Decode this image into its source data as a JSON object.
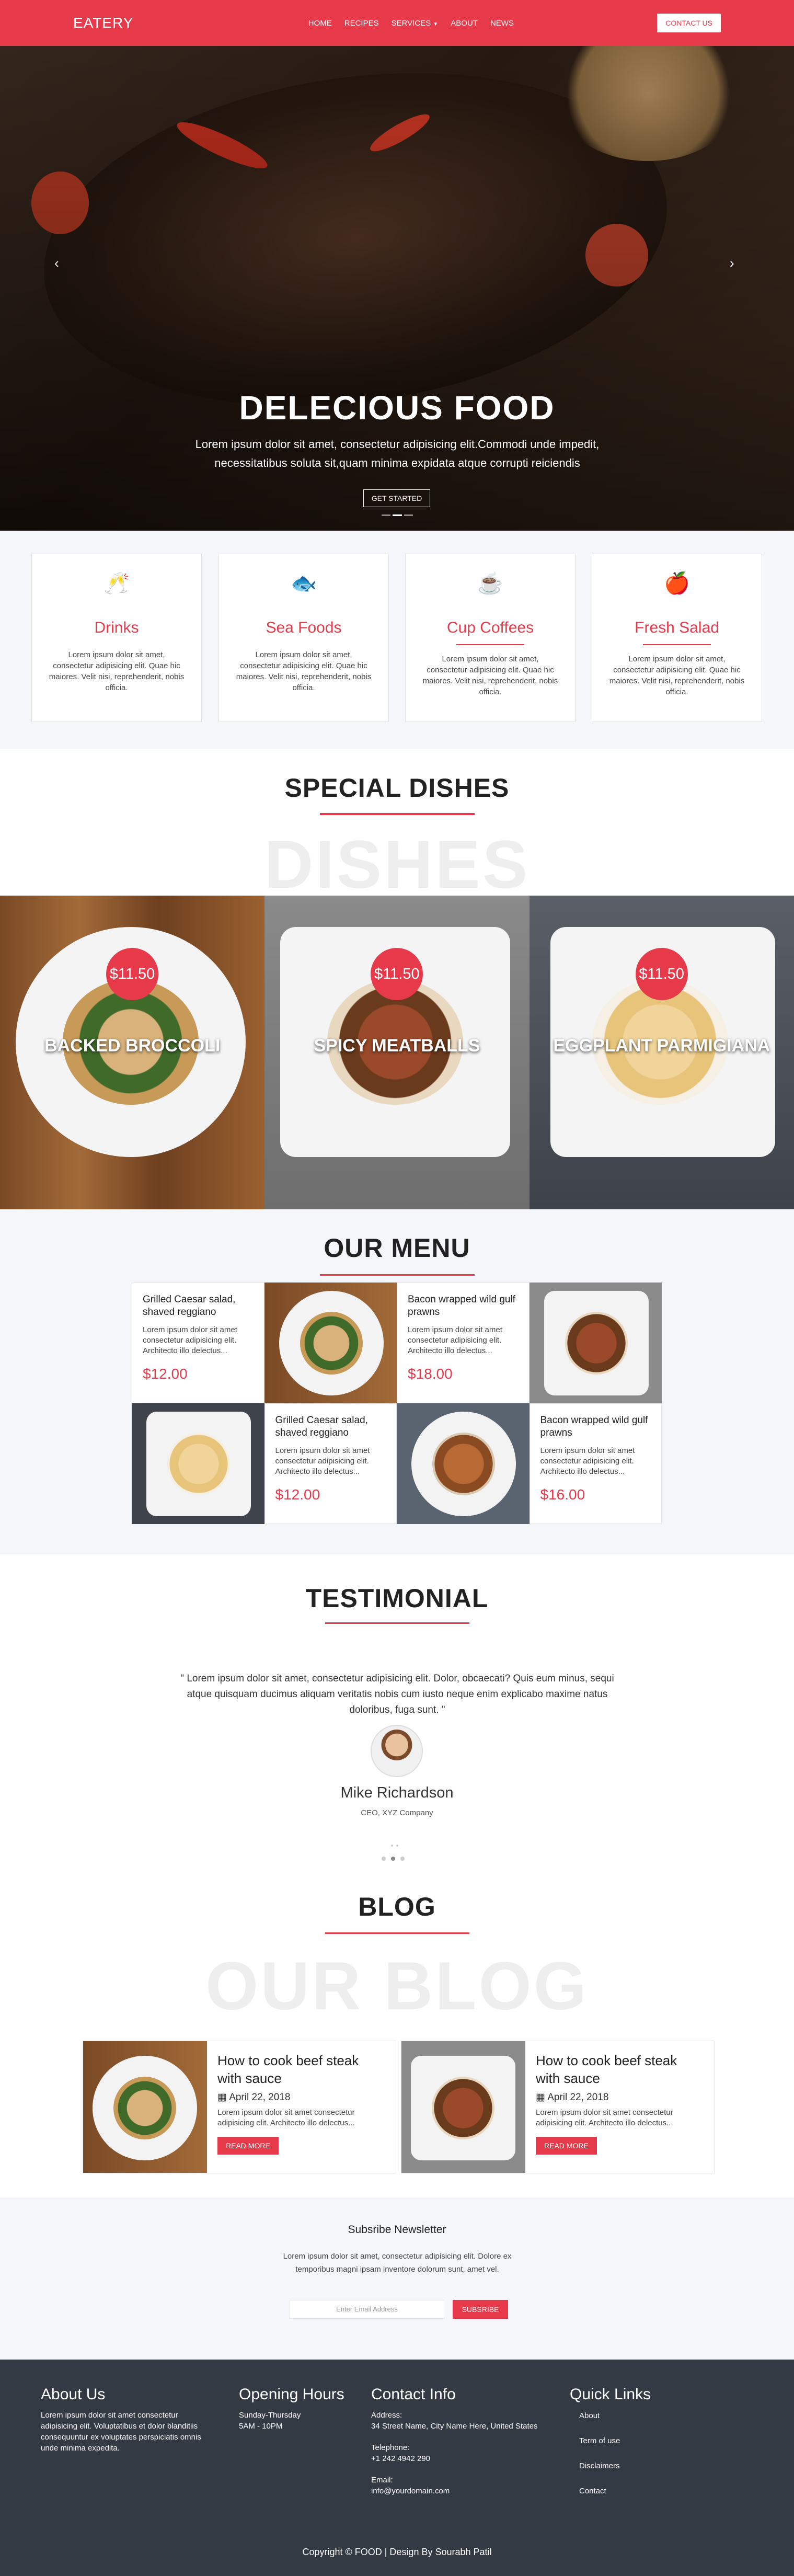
{
  "nav": {
    "logo": "EATERY",
    "items": [
      "HOME",
      "RECIPES",
      "SERVICES",
      "ABOUT",
      "NEWS"
    ],
    "contact": "CONTACT US"
  },
  "hero": {
    "title": "DELECIOUS FOOD",
    "text": "Lorem ipsum dolor sit amet, consectetur adipisicing elit.Commodi unde impedit, necessitatibus soluta sit,quam minima expidata atque corrupti reiciendis",
    "cta": "GET STARTED"
  },
  "features": [
    {
      "title": "Drinks",
      "icon": "glasses-icon",
      "glyph": "🥂",
      "text": "Lorem ipsum dolor sit amet, consectetur adipisicing elit. Quae hic maiores. Velit nisi, reprehenderit, nobis officia."
    },
    {
      "title": "Sea Foods",
      "icon": "fish-icon",
      "glyph": "🐟",
      "text": "Lorem ipsum dolor sit amet, consectetur adipisicing elit. Quae hic maiores. Velit nisi, reprehenderit, nobis officia."
    },
    {
      "title": "Cup Coffees",
      "icon": "coffee-icon",
      "glyph": "☕",
      "text": "Lorem ipsum dolor sit amet, consectetur adipisicing elit. Quae hic maiores. Velit nisi, reprehenderit, nobis officia."
    },
    {
      "title": "Fresh Salad",
      "icon": "apple-icon",
      "glyph": "🍎",
      "text": "Lorem ipsum dolor sit amet, consectetur adipisicing elit. Quae hic maiores. Velit nisi, reprehenderit, nobis officia."
    }
  ],
  "special": {
    "title": "SPECIAL DISHES",
    "ghost": "DISHES",
    "dishes": [
      {
        "name": "BACKED BROCCOLI",
        "price": "$11.50"
      },
      {
        "name": "SPICY MEATBALLS",
        "price": "$11.50"
      },
      {
        "name": "EGGPLANT PARMIGIANA",
        "price": "$11.50"
      }
    ]
  },
  "menu": {
    "title": "OUR MENU",
    "items": [
      {
        "name": "Grilled Caesar salad, shaved reggiano",
        "desc": "Lorem ipsum dolor sit amet consectetur adipisicing elit. Architecto illo delectus...",
        "price": "$12.00"
      },
      {
        "name": "Bacon wrapped wild gulf prawns",
        "desc": "Lorem ipsum dolor sit amet consectetur adipisicing elit. Architecto illo delectus...",
        "price": "$18.00"
      },
      {
        "name": "Grilled Caesar salad, shaved reggiano",
        "desc": "Lorem ipsum dolor sit amet consectetur adipisicing elit. Architecto illo delectus...",
        "price": "$12.00"
      },
      {
        "name": "Bacon wrapped wild gulf prawns",
        "desc": "Lorem ipsum dolor sit amet consectetur adipisicing elit. Architecto illo delectus...",
        "price": "$16.00"
      }
    ]
  },
  "testimonial": {
    "title": "TESTIMONIAL",
    "quote": "\" Lorem ipsum dolor sit amet, consectetur adipisicing elit. Dolor, obcaecati? Quis eum minus, sequi atque quisquam ducimus aliquam veritatis nobis cum iusto neque enim explicabo maxime natus doloribus, fuga sunt. \"",
    "name": "Mike Richardson",
    "role": "CEO, XYZ Company"
  },
  "blog": {
    "title": "BLOG",
    "ghost": "OUR BLOG",
    "posts": [
      {
        "title": "How to cook beef steak with sauce",
        "date": "April 22, 2018",
        "text": "Lorem ipsum dolor sit amet consectetur adipisicing elit. Architecto illo delectus...",
        "cta": "READ MORE"
      },
      {
        "title": "How to cook beef steak with sauce",
        "date": "April 22, 2018",
        "text": "Lorem ipsum dolor sit amet consectetur adipisicing elit. Architecto illo delectus...",
        "cta": "READ MORE"
      }
    ]
  },
  "newsletter": {
    "title": "Subsribe Newsletter",
    "text": "Lorem ipsum dolor sit amet, consectetur adipisicing elit. Dolore ex temporibus magni ipsam inventore dolorum sunt, amet vel.",
    "placeholder": "Enter Email Address",
    "button": "SUBSRIBE"
  },
  "footer": {
    "about_title": "About Us",
    "about_text": "Lorem ipsum dolor sit amet consectetur adipisicing elit. Voluptatibus et dolor blanditiis consequuntur ex voluptates perspiciatis omnis unde minima expedita.",
    "hours_title": "Opening Hours",
    "hours_days": "Sunday-Thursday",
    "hours_time": "5AM - 10PM",
    "contact_title": "Contact Info",
    "address_label": "Address:",
    "address": "34 Street Name, City Name Here, United States",
    "phone_label": "Telephone:",
    "phone": "+1 242 4942 290",
    "email_label": "Email:",
    "email": "info@yourdomain.com",
    "links_title": "Quick Links",
    "links": [
      "About",
      "Term of use",
      "Disclaimers",
      "Contact"
    ],
    "copyright": "Copyright © FOOD | Design By Sourabh Patil"
  },
  "colors": {
    "accent": "#e63a4b",
    "footer": "#343a44"
  }
}
